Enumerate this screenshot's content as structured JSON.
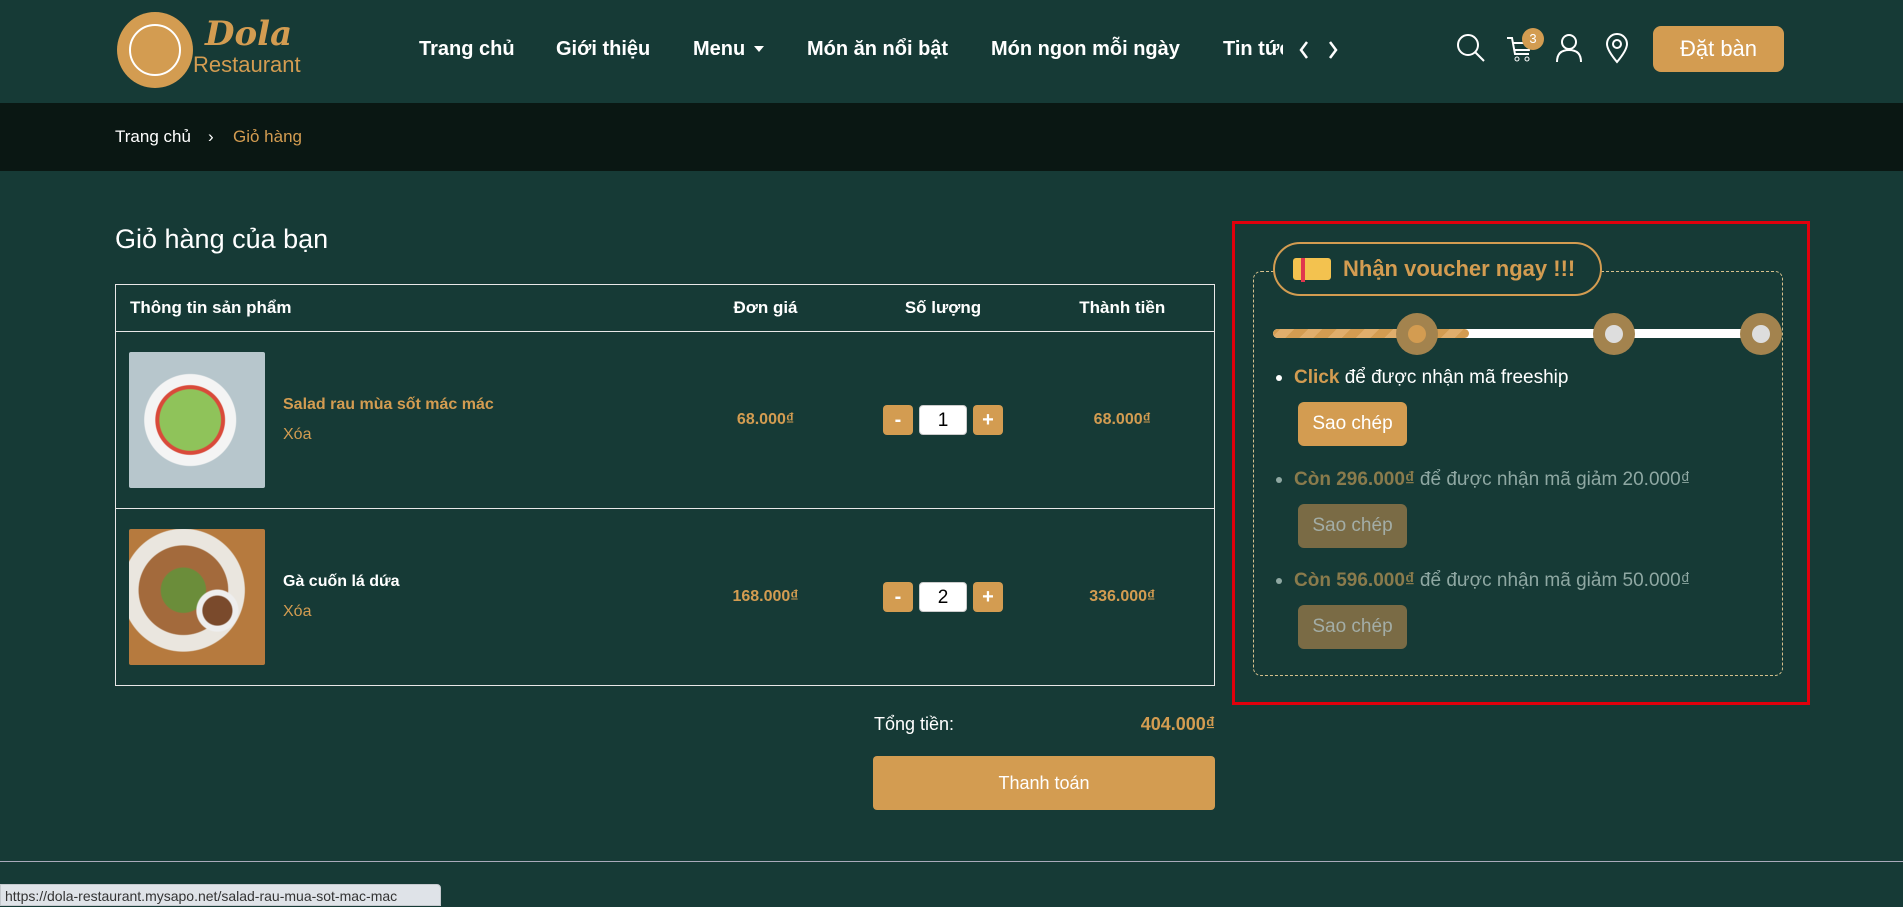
{
  "header": {
    "logo": {
      "line1": "Dola",
      "line2": "Restaurant"
    },
    "nav": [
      "Trang chủ",
      "Giới thiệu",
      "Menu",
      "Món ăn nổi bật",
      "Món ngon mỗi ngày",
      "Tin tức"
    ],
    "cart_count": "3",
    "book_label": "Đặt bàn"
  },
  "breadcrumb": {
    "home": "Trang chủ",
    "current": "Giỏ hàng"
  },
  "cart": {
    "title": "Giỏ hàng của bạn",
    "columns": [
      "Thông tin sản phẩm",
      "Đơn giá",
      "Số lượng",
      "Thành tiền"
    ],
    "items": [
      {
        "name": "Salad rau mùa sốt mác mác",
        "remove": "Xóa",
        "price": "68.000₫",
        "qty": "1",
        "total": "68.000₫"
      },
      {
        "name": "Gà cuốn lá dứa",
        "remove": "Xóa",
        "price": "168.000₫",
        "qty": "2",
        "total": "336.000₫"
      }
    ],
    "total_label": "Tổng tiền:",
    "total_value": "404.000₫",
    "checkout": "Thanh toán"
  },
  "voucher": {
    "title": "Nhận voucher ngay !!!",
    "progress_steps_reached": 1,
    "progress_steps_total": 3,
    "items": [
      {
        "highlight": "Click",
        "text": " để được nhận mã freeship",
        "button": "Sao chép",
        "enabled": true
      },
      {
        "highlight": "Còn 296.000₫",
        "text": " để được nhận mã giảm 20.000₫",
        "button": "Sao chép",
        "enabled": false
      },
      {
        "highlight": "Còn 596.000₫",
        "text": " để được nhận mã giảm 50.000₫",
        "button": "Sao chép",
        "enabled": false
      }
    ]
  },
  "status_url": "https://dola-restaurant.mysapo.net/salad-rau-mua-sot-mac-mac",
  "colors": {
    "bg": "#163a36",
    "accent": "#d39c51",
    "highlight_box": "#e0000c"
  }
}
